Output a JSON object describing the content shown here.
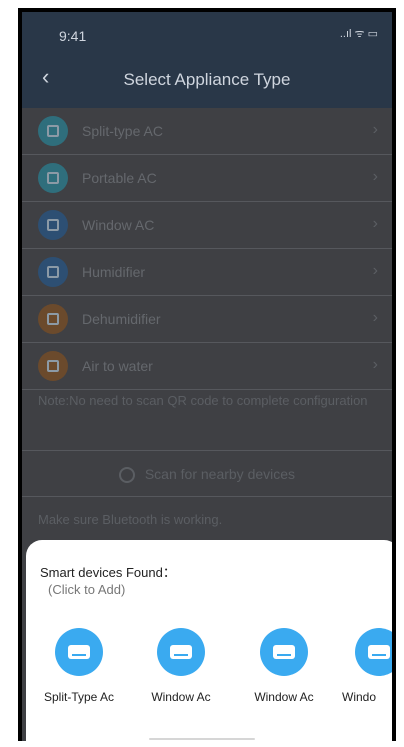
{
  "status_bar": {
    "time": "9:41",
    "icons": "..ıl ᯤ ▭"
  },
  "nav": {
    "back_glyph": "‹",
    "title": "Select Appliance Type"
  },
  "appliances": [
    {
      "label": "Split-type AC",
      "icon": "split-ac-icon",
      "color": "#2f6e7c"
    },
    {
      "label": "Portable AC",
      "icon": "portable-ac-icon",
      "color": "#2f6e7c"
    },
    {
      "label": "Window AC",
      "icon": "window-ac-icon",
      "color": "#2d4f73"
    },
    {
      "label": "Humidifier",
      "icon": "humidifier-icon",
      "color": "#2d4f73"
    },
    {
      "label": "Dehumidifier",
      "icon": "dehumidifier-icon",
      "color": "#6b4a2c"
    },
    {
      "label": "Air to water",
      "icon": "air-to-water-icon",
      "color": "#6b4a2c"
    }
  ],
  "chevron_glyph": "›",
  "note": "Note:No need to scan QR code to complete configuration",
  "scan_label": "Scan for nearby devices",
  "bt_note": "Make sure Bluetooth is working.",
  "sheet": {
    "title": "Smart devices Found：",
    "subtitle": "(Click to Add)",
    "devices": [
      {
        "label": "Split-Type Ac"
      },
      {
        "label": "Window Ac"
      },
      {
        "label": "Window Ac"
      },
      {
        "label": "Windo"
      }
    ]
  },
  "colors": {
    "nav_bg": "#293748",
    "overlay_bg": "#3f4044",
    "device_blue": "#3aaaf0"
  }
}
